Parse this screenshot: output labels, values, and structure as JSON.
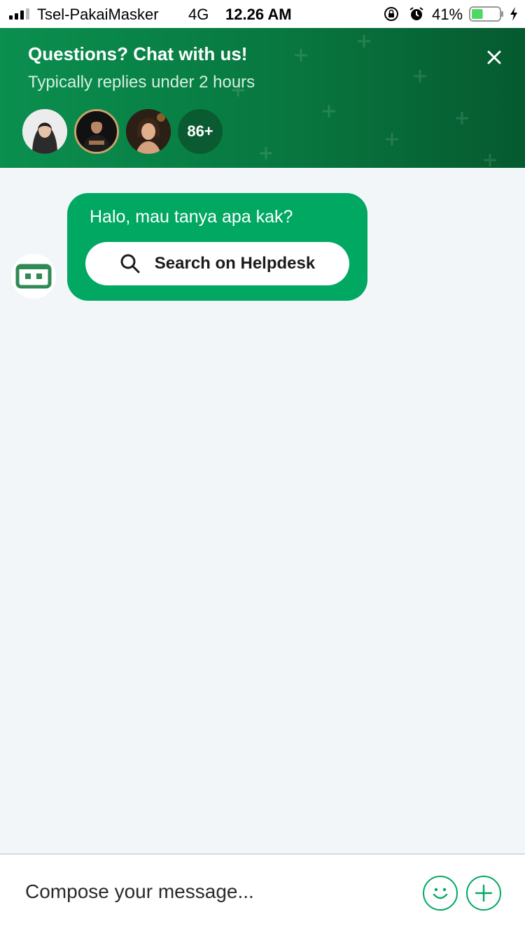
{
  "status_bar": {
    "carrier": "Tsel-PakaiMasker",
    "network": "4G",
    "time": "12.26 AM",
    "battery_percent": "41%",
    "battery_level": 0.41,
    "icons": [
      "signal-icon",
      "rotation-lock-icon",
      "alarm-icon",
      "battery-icon",
      "charging-icon"
    ]
  },
  "header": {
    "title": "Questions? Chat with us!",
    "subtitle": "Typically replies under 2 hours",
    "more_agents": "86+",
    "colors": {
      "bg_start": "#0a8f4f",
      "bg_end": "#055a2f"
    }
  },
  "chat": {
    "bot_message": "Halo, mau tanya apa kak?",
    "helpdesk_button": "Search on Helpdesk",
    "bubble_color": "#00a862"
  },
  "composer": {
    "placeholder": "Compose your message...",
    "accent": "#00a862"
  }
}
